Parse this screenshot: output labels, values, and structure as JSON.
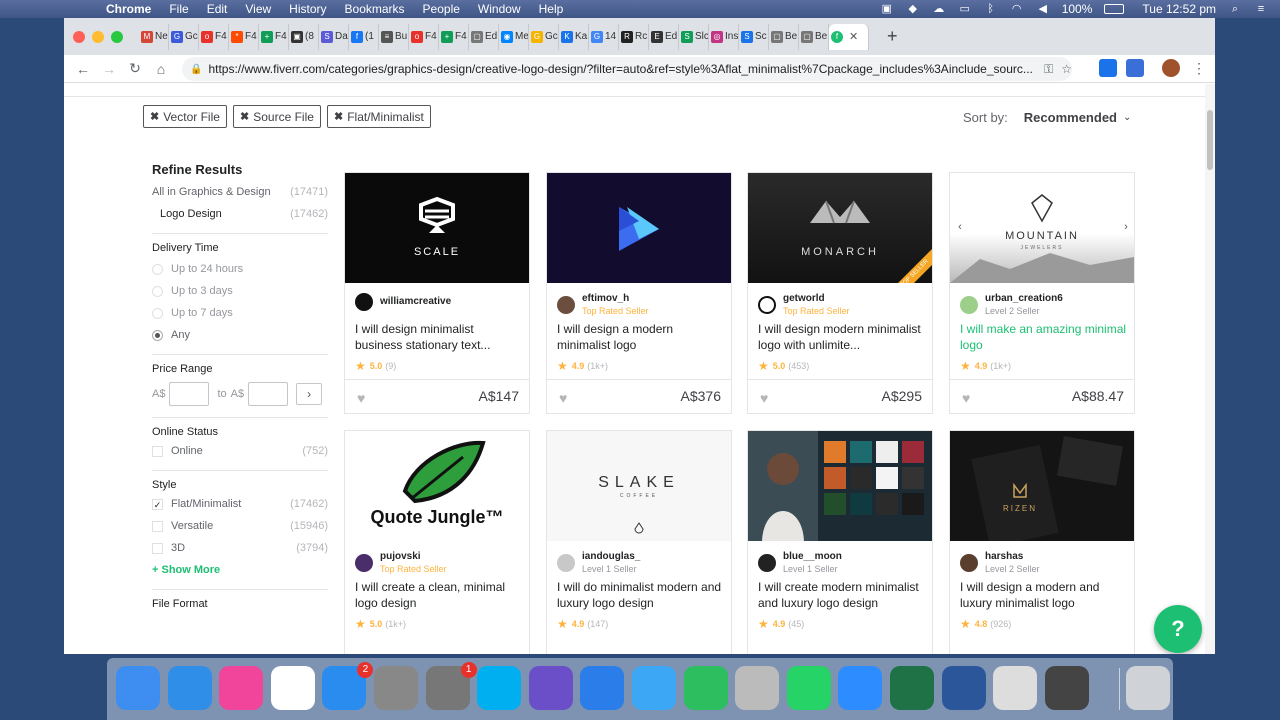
{
  "menubar": {
    "app": "Chrome",
    "items": [
      "File",
      "Edit",
      "View",
      "History",
      "Bookmarks",
      "People",
      "Window",
      "Help"
    ],
    "battery": "100%",
    "clock": "Tue 12:52 pm"
  },
  "browser": {
    "tabs": [
      {
        "label": "Ne",
        "color": "#d44638",
        "icon": "M"
      },
      {
        "label": "Gc",
        "color": "#3b5bdb",
        "icon": "G"
      },
      {
        "label": "F4",
        "color": "#e8312b",
        "icon": "o"
      },
      {
        "label": "F4",
        "color": "#ff4a00",
        "icon": "*"
      },
      {
        "label": "F4",
        "color": "#0f9d58",
        "icon": "+"
      },
      {
        "label": "(8",
        "color": "#333333",
        "icon": "▣"
      },
      {
        "label": "Da",
        "color": "#5b5bd6",
        "icon": "S"
      },
      {
        "label": "(1",
        "color": "#1877f2",
        "icon": "f"
      },
      {
        "label": "Bu",
        "color": "#555555",
        "icon": "≡"
      },
      {
        "label": "F4",
        "color": "#e8312b",
        "icon": "o"
      },
      {
        "label": "F4",
        "color": "#0f9d58",
        "icon": "+"
      },
      {
        "label": "Ed",
        "color": "#777777",
        "icon": "▢"
      },
      {
        "label": "Me",
        "color": "#0084ff",
        "icon": "◉"
      },
      {
        "label": "Gc",
        "color": "#f4b400",
        "icon": "G"
      },
      {
        "label": "Ka",
        "color": "#1a73e8",
        "icon": "K"
      },
      {
        "label": "14",
        "color": "#4285f4",
        "icon": "G"
      },
      {
        "label": "Rc",
        "color": "#222222",
        "icon": "R"
      },
      {
        "label": "Ed",
        "color": "#333333",
        "icon": "E"
      },
      {
        "label": "Slc",
        "color": "#0f9d58",
        "icon": "S"
      },
      {
        "label": "Ins",
        "color": "#c13584",
        "icon": "◎"
      },
      {
        "label": "Sc",
        "color": "#1a73e8",
        "icon": "S"
      },
      {
        "label": "Be",
        "color": "#777777",
        "icon": "▢"
      },
      {
        "label": "Be",
        "color": "#777777",
        "icon": "▢"
      }
    ],
    "active_tab_icon": "fiverr",
    "url": "https://www.fiverr.com/categories/graphics-design/creative-logo-design/?filter=auto&ref=style%3Aflat_minimalist%7Cpackage_includes%3Ainclude_sourc..."
  },
  "filters": {
    "chips": [
      "Vector File",
      "Source File",
      "Flat/Minimalist"
    ],
    "sort_label": "Sort by:",
    "sort_value": "Recommended"
  },
  "sidebar": {
    "refine_title": "Refine Results",
    "all_label": "All in Graphics & Design",
    "all_count": "(17471)",
    "logo_label": "Logo Design",
    "logo_count": "(17462)",
    "delivery_title": "Delivery Time",
    "delivery_options": [
      "Up to 24 hours",
      "Up to 3 days",
      "Up to 7 days",
      "Any"
    ],
    "price_title": "Price Range",
    "price_currency": "A$",
    "price_to": "to",
    "online_title": "Online Status",
    "online_label": "Online",
    "online_count": "(752)",
    "style_title": "Style",
    "styles": [
      {
        "label": "Flat/Minimalist",
        "count": "(17462)",
        "checked": true
      },
      {
        "label": "Versatile",
        "count": "(15946)",
        "checked": false
      },
      {
        "label": "3D",
        "count": "(3794)",
        "checked": false
      }
    ],
    "show_more": "+ Show More",
    "file_format_title": "File Format"
  },
  "gigs": [
    {
      "seller": "williamcreative",
      "level": "",
      "title": "I will design minimalist business stationary text...",
      "rating": "5.0",
      "reviews": "(9)",
      "price": "A$147",
      "image_text": "SCALE"
    },
    {
      "seller": "eftimov_h",
      "level": "Top Rated Seller",
      "title": "I will design a modern minimalist logo",
      "rating": "4.9",
      "reviews": "(1k+)",
      "price": "A$376",
      "image_text": ""
    },
    {
      "seller": "getworld",
      "level": "Top Rated Seller",
      "title": "I will design modern minimalist logo with unlimite...",
      "rating": "5.0",
      "reviews": "(453)",
      "price": "A$295",
      "image_text": "MONARCH",
      "ribbon": "TOP SELLER"
    },
    {
      "seller": "urban_creation6",
      "level": "Level 2 Seller",
      "title": "I will make an amazing minimal logo",
      "rating": "4.9",
      "reviews": "(1k+)",
      "price": "A$88.47",
      "image_text": "MOUNTAIN",
      "image_subtext": "JEWELERS"
    },
    {
      "seller": "pujovski",
      "level": "Top Rated Seller",
      "title": "I will create a clean, minimal logo design",
      "rating": "5.0",
      "reviews": "(1k+)",
      "price": "",
      "image_text": "Quote Jungle™"
    },
    {
      "seller": "iandouglas_",
      "level": "Level 1 Seller",
      "title": "I will do minimalist modern and luxury logo design",
      "rating": "4.9",
      "reviews": "(147)",
      "price": "",
      "image_text": "SLAKE",
      "image_subtext": "COFFEE"
    },
    {
      "seller": "blue__moon",
      "level": "Level 1 Seller",
      "title": "I will create modern minimalist and luxury logo design",
      "rating": "4.9",
      "reviews": "(45)",
      "price": "",
      "image_text": ""
    },
    {
      "seller": "harshas",
      "level": "Level 2 Seller",
      "title": "I will design a modern and luxury minimalist logo",
      "rating": "4.8",
      "reviews": "(926)",
      "price": "",
      "image_text": "RIZEN"
    }
  ],
  "help_button": "?",
  "dock": {
    "apps": [
      {
        "name": "finder",
        "color": "#3d8ef0"
      },
      {
        "name": "safari",
        "color": "#2f8ee8"
      },
      {
        "name": "itunes",
        "color": "#f0459a"
      },
      {
        "name": "chrome",
        "color": "#ffffff"
      },
      {
        "name": "app-store",
        "color": "#2b8cf0",
        "badge": "2"
      },
      {
        "name": "image-capture",
        "color": "#888888"
      },
      {
        "name": "system-preferences",
        "color": "#777777",
        "badge": "1"
      },
      {
        "name": "skype",
        "color": "#00aff0"
      },
      {
        "name": "imovie",
        "color": "#6a4fc9"
      },
      {
        "name": "keynote",
        "color": "#2b7de9"
      },
      {
        "name": "messages",
        "color": "#3ca8f5"
      },
      {
        "name": "evernote",
        "color": "#2dbe60"
      },
      {
        "name": "disk-utility",
        "color": "#bbbbbb"
      },
      {
        "name": "whatsapp",
        "color": "#25d366"
      },
      {
        "name": "zoom",
        "color": "#2d8cff"
      },
      {
        "name": "excel",
        "color": "#1f7246"
      },
      {
        "name": "word",
        "color": "#2b579a"
      },
      {
        "name": "instruments",
        "color": "#dddddd"
      },
      {
        "name": "printer",
        "color": "#444444"
      },
      {
        "name": "trash",
        "color": "#cfd3d8"
      }
    ]
  },
  "colors": {
    "fiverr_green": "#1dbf73",
    "top_rated": "#ffb33e"
  }
}
